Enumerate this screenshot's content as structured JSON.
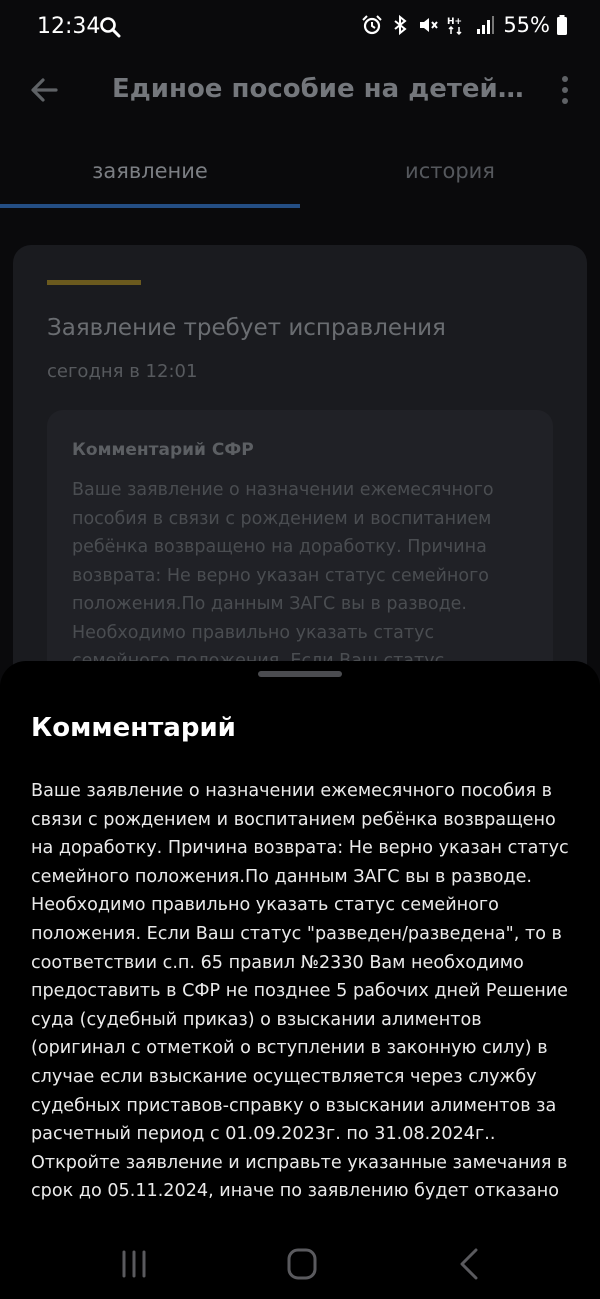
{
  "status_bar": {
    "time": "12:34",
    "battery": "55%",
    "icons": [
      "search-icon",
      "alarm-icon",
      "bluetooth-icon",
      "mute-icon",
      "data-h-plus-icon",
      "signal-icon",
      "battery-icon"
    ]
  },
  "app_bar": {
    "title": "Единое пособие на детей и б...",
    "back_icon": "arrow-left-icon",
    "menu_icon": "more-vertical-icon"
  },
  "tabs": [
    {
      "label": "заявление",
      "selected": true
    },
    {
      "label": "история",
      "selected": false
    }
  ],
  "card": {
    "accent_color": "#6b5a1e",
    "title": "Заявление требует исправления",
    "date": "сегодня в 12:01",
    "comment_heading": "Комментарий СФР",
    "comment_preview": "Ваше заявление о назначении ежемесячного пособия в связи с рождением и воспитанием ребёнка возвращено на доработку. Причина возврата: Не верно указан статус семейного положения.По данным ЗАГС вы в разводе. Необходимо правильно указать статус семейного положения. Если Ваш статус"
  },
  "sheet": {
    "title": "Комментарий",
    "text": "Ваше заявление о назначении ежемесячного пособия в связи с рождением и воспитанием ребёнка возвращено на доработку. Причина возврата: Не верно указан статус семейного положения.По данным ЗАГС вы в разводе. Необходимо правильно указать статус семейного положения. Если Ваш статус \"разведен/разведена\", то в соответствии с.п. 65 правил №2330 Вам необходимо предоставить в СФР не позднее 5 рабочих дней Решение суда (судебный приказ) о взыскании алиментов (оригинал с отметкой о вступлении в законную силу) в случае если взыскание осуществляется через службу судебных приставов-справку о взыскании алиментов за расчетный период с 01.09.2023г. по 31.08.2024г.. Откройте заявление и исправьте указанные замечания в срок до 05.11.2024, иначе по заявлению будет отказано"
  },
  "nav_bar": {
    "buttons": [
      "recent-apps-icon",
      "home-icon",
      "back-icon"
    ]
  }
}
